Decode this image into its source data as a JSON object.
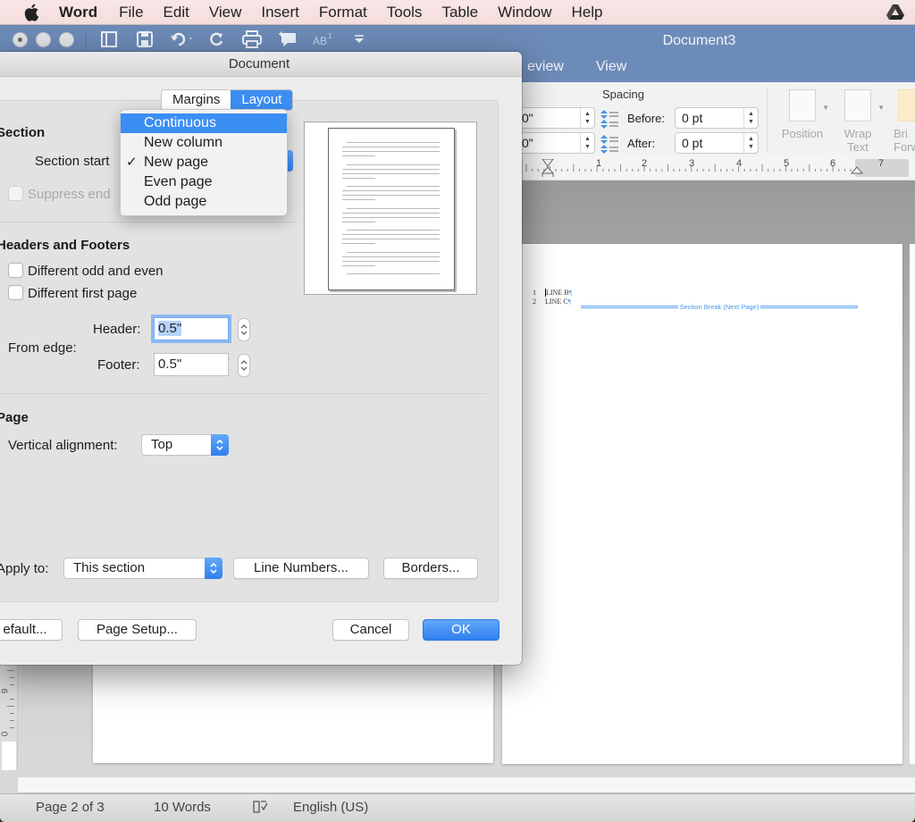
{
  "menubar": {
    "app": "Word",
    "items": [
      "File",
      "Edit",
      "View",
      "Insert",
      "Format",
      "Tools",
      "Table",
      "Window",
      "Help"
    ],
    "icons": [
      "apple-icon",
      "google-drive-icon"
    ]
  },
  "window": {
    "title": "Document3",
    "ribbon_tabs": [
      "eview",
      "View"
    ],
    "quick_access": [
      "sidebar-icon",
      "save-icon",
      "undo-icon",
      "redo-icon",
      "print-icon",
      "comment-icon",
      "footnote-icon",
      "customize-icon"
    ]
  },
  "ribbon": {
    "spacing_label": "Spacing",
    "indent_left_value": "0\"",
    "indent_right_value": "0\"",
    "before_label": "Before:",
    "before_value": "0 pt",
    "after_label": "After:",
    "after_value": "0 pt",
    "position_label": "Position",
    "wrap_text_label": "Wrap\nText",
    "bring_forward_label": "Bri\nForw"
  },
  "ruler": {
    "numbers": [
      "1",
      "2",
      "3",
      "4",
      "5",
      "6",
      "7"
    ]
  },
  "vertical_ruler": {
    "numbers": [
      "9",
      "0"
    ]
  },
  "document": {
    "lines": [
      {
        "number": "1",
        "text": "LINE B"
      },
      {
        "number": "2",
        "text": "LINE C"
      }
    ],
    "section_break": "Section Break (Next Page)"
  },
  "statusbar": {
    "page": "Page 2 of 3",
    "words": "10 Words",
    "language": "English (US)"
  },
  "dialog": {
    "title": "Document",
    "tabs": {
      "margins": "Margins",
      "layout": "Layout",
      "active": "Layout"
    },
    "section": {
      "heading": "Section",
      "section_start_label": "Section start",
      "suppress_endnotes_label": "Suppress end",
      "dropdown": {
        "options": [
          "Continuous",
          "New column",
          "New page",
          "Even page",
          "Odd page"
        ],
        "selected": "New page",
        "highlighted": "Continuous"
      }
    },
    "headers_footers": {
      "heading": "Headers and Footers",
      "different_odd_even": "Different odd and even",
      "different_first_page": "Different first page",
      "from_edge_label": "From edge:",
      "header_label": "Header:",
      "header_value": "0.5\"",
      "footer_label": "Footer:",
      "footer_value": "0.5\""
    },
    "page": {
      "heading": "Page",
      "vertical_alignment_label": "Vertical alignment:",
      "vertical_alignment_value": "Top"
    },
    "apply_to_label": "Apply to:",
    "apply_to_value": "This section",
    "line_numbers_button": "Line Numbers...",
    "borders_button": "Borders...",
    "default_button": "efault...",
    "page_setup_button": "Page Setup...",
    "cancel_button": "Cancel",
    "ok_button": "OK"
  },
  "colors": {
    "accent": "#3b8ef3",
    "titlebar": "#6d8bb8",
    "section_break": "#4a95e0"
  }
}
